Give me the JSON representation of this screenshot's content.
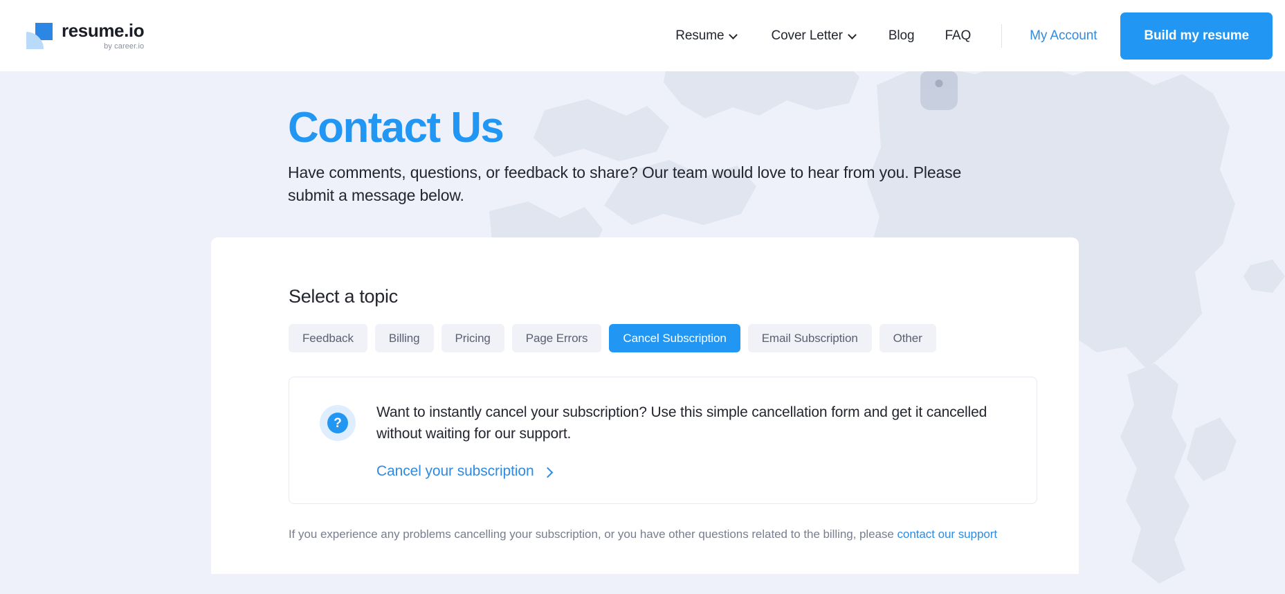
{
  "header": {
    "brand_name": "resume.io",
    "brand_sub": "by career.io",
    "nav": [
      {
        "label": "Resume",
        "has_caret": true
      },
      {
        "label": "Cover Letter",
        "has_caret": true
      },
      {
        "label": "Blog",
        "has_caret": false
      },
      {
        "label": "FAQ",
        "has_caret": false
      }
    ],
    "account_label": "My Account",
    "cta_label": "Build my resume",
    "accent_color": "#2196f3",
    "link_color": "#2f8ae0"
  },
  "hero": {
    "title": "Contact Us",
    "subtitle": "Have comments, questions, or feedback to share? Our team would love to hear from you. Please submit a message below."
  },
  "card": {
    "section_title": "Select a topic",
    "topics": [
      {
        "label": "Feedback",
        "selected": false
      },
      {
        "label": "Billing",
        "selected": false
      },
      {
        "label": "Pricing",
        "selected": false
      },
      {
        "label": "Page Errors",
        "selected": false
      },
      {
        "label": "Cancel Subscription",
        "selected": true
      },
      {
        "label": "Email Subscription",
        "selected": false
      },
      {
        "label": "Other",
        "selected": false
      }
    ],
    "info_box": {
      "icon": "question-mark-icon",
      "icon_glyph": "?",
      "text": "Want to instantly cancel your subscription? Use this simple cancellation form and get it cancelled without waiting for our support.",
      "link_label": "Cancel your subscription"
    },
    "footnote_text": "If you experience any problems cancelling your subscription, or you have other questions related to the billing, please ",
    "footnote_link": "contact our support"
  }
}
